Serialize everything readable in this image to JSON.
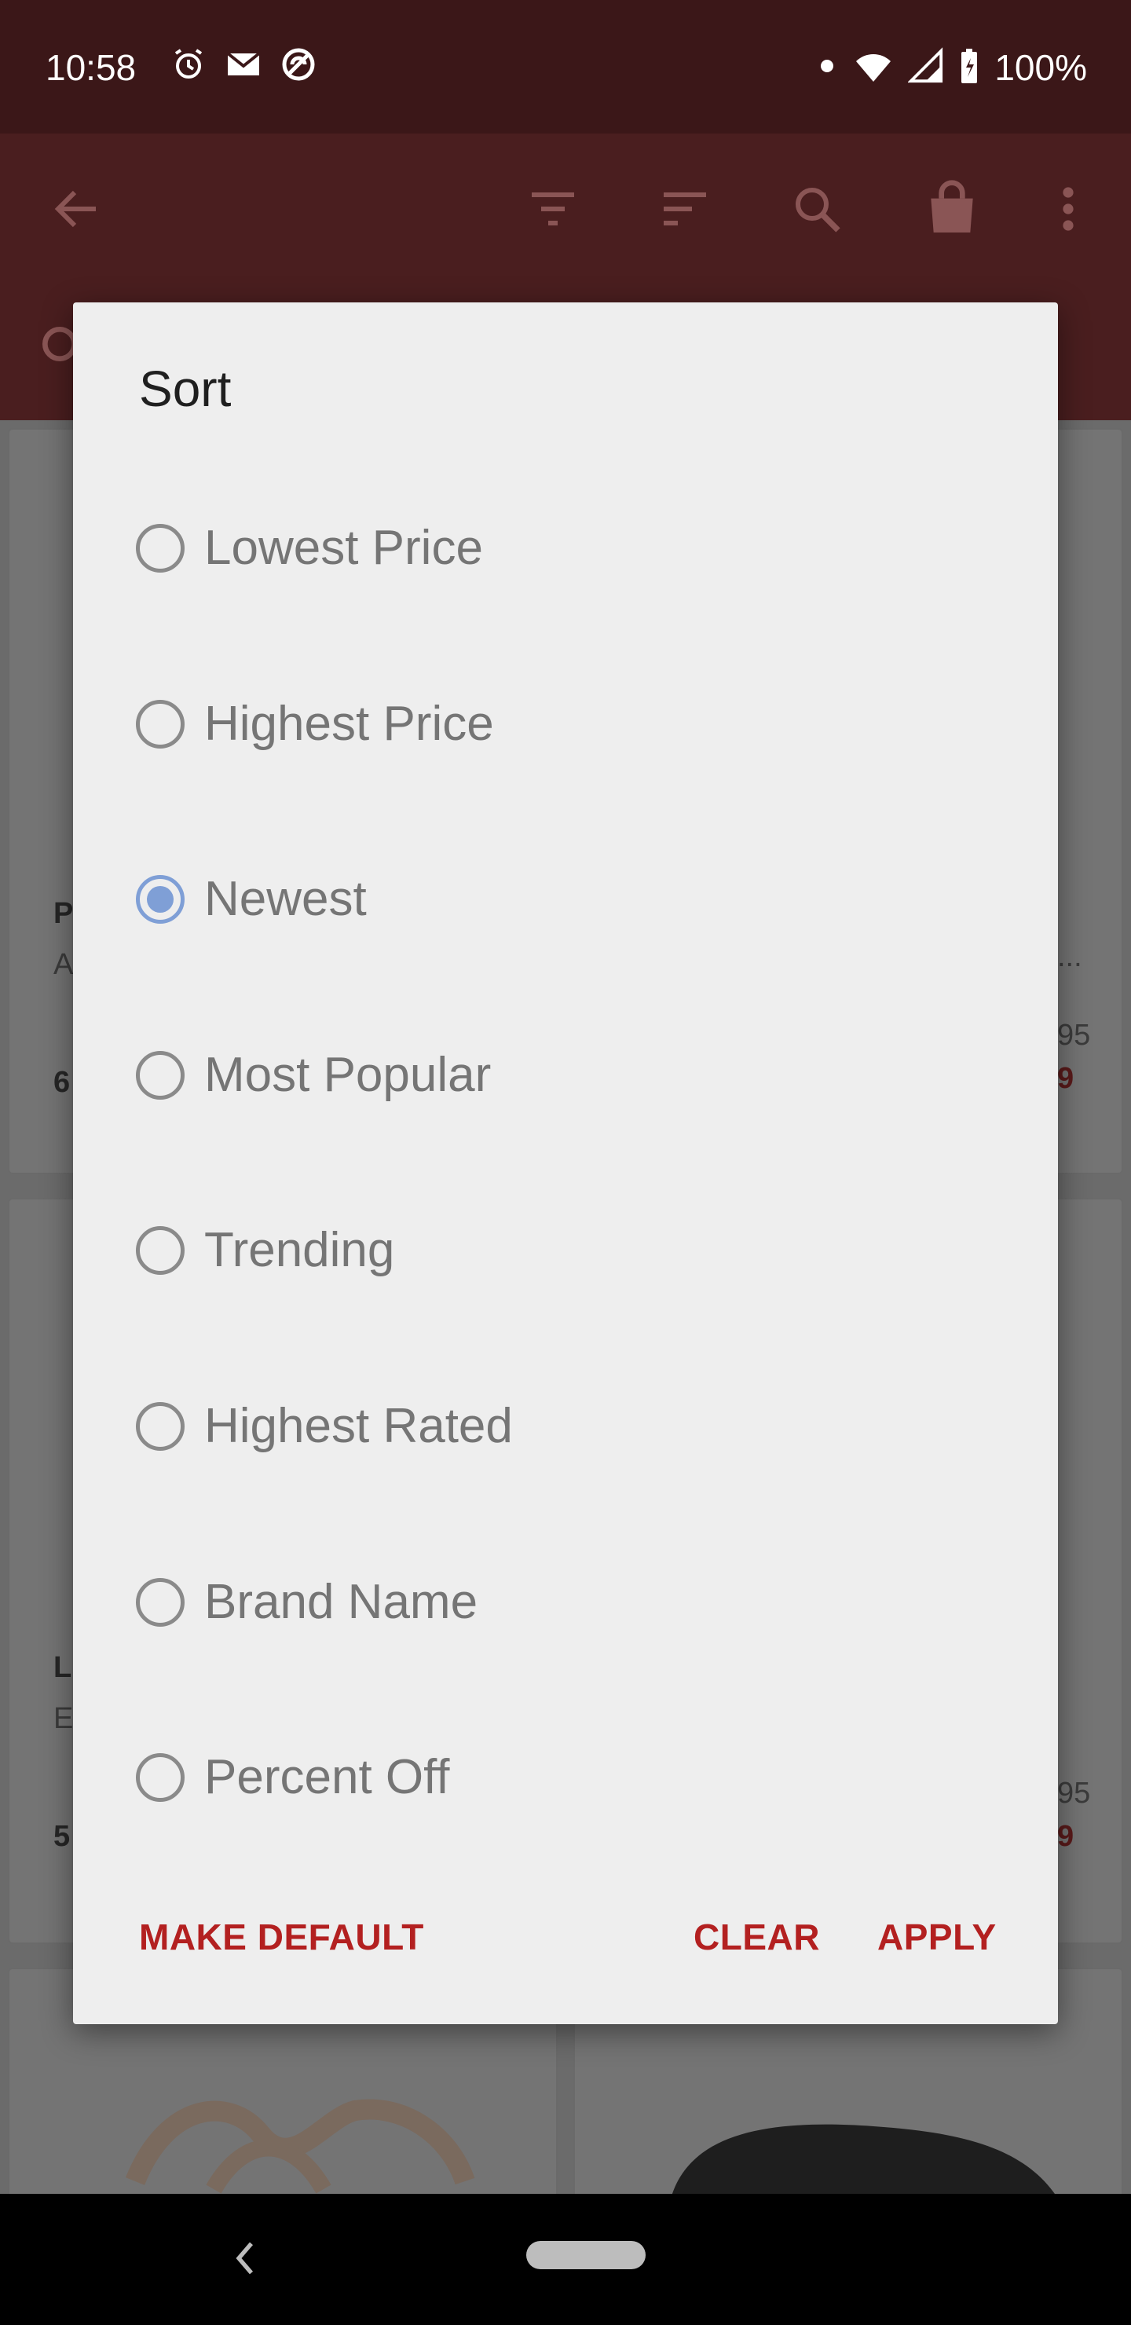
{
  "status_bar": {
    "time": "10:58",
    "battery": "100%",
    "icons": [
      "alarm-icon",
      "gmail-icon",
      "sync-icon",
      "notification-dot-icon",
      "wifi-icon",
      "signal-icon",
      "battery-charging-icon"
    ]
  },
  "app_bar": {
    "icons": [
      "back-arrow-icon",
      "filter-icon",
      "sort-icon",
      "search-icon",
      "shopping-bag-icon",
      "more-vert-icon"
    ]
  },
  "background_cards": {
    "card1": {
      "title": "P",
      "subtitle": "A",
      "price": "6"
    },
    "card2": {
      "subtitle": "...",
      "old_price": "95",
      "price": "9"
    },
    "card3": {
      "title": "L",
      "subtitle": "E",
      "price": "5"
    },
    "card4": {
      "old_price": "95",
      "price": "9"
    }
  },
  "dialog": {
    "title": "Sort",
    "selected": "Newest",
    "options": [
      {
        "label": "Lowest Price",
        "checked": false
      },
      {
        "label": "Highest Price",
        "checked": false
      },
      {
        "label": "Newest",
        "checked": true
      },
      {
        "label": "Most Popular",
        "checked": false
      },
      {
        "label": "Trending",
        "checked": false
      },
      {
        "label": "Highest Rated",
        "checked": false
      },
      {
        "label": "Brand Name",
        "checked": false
      },
      {
        "label": "Percent Off",
        "checked": false
      }
    ],
    "actions": {
      "make_default": "MAKE DEFAULT",
      "clear": "CLEAR",
      "apply": "APPLY"
    }
  },
  "colors": {
    "status_bar": "#3b1718",
    "app_bar": "#4a1e1f",
    "accent": "#b32020",
    "radio_selected": "#7f9fd6",
    "dialog_bg": "#eeeeee"
  }
}
